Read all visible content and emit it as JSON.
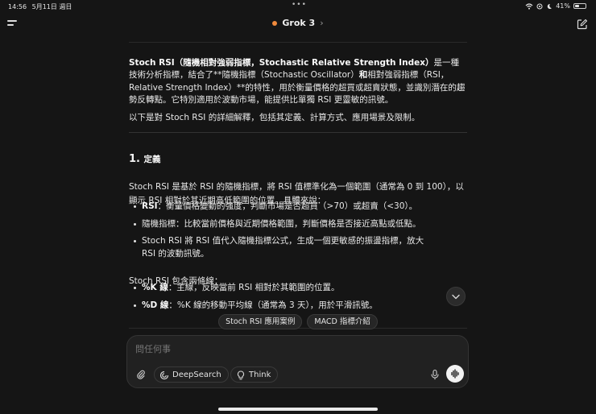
{
  "status_bar": {
    "time": "14:56",
    "date": "5月11日 週日",
    "battery": "41%",
    "battery_level": 0.41
  },
  "header": {
    "model_name": "Grok 3",
    "accent_color": "#f08a3c"
  },
  "article": {
    "intro_bold_1": "Stoch RSI（隨機相對強弱指標，Stochastic Relative Strength Index）",
    "intro_text_1": "是一種技術分析指標，結合了**隨機指標（Stochastic Oscillator）",
    "intro_bold_2": "和",
    "intro_text_2": "相對強弱指標（RSI，Relative Strength Index）**的特性，用於衡量價格的超買或超賣狀態，並識別潛在的趨勢反轉點。它特別適用於波動市場，能提供比單獨 RSI 更靈敏的訊號。",
    "intro_2": "以下是對 Stoch RSI 的詳細解釋，包括其定義、計算方式、應用場景及限制。",
    "section_1_number": "1.",
    "section_1_title": "定義",
    "section_1_para": "Stoch RSI 是基於 RSI 的隨機指標，將 RSI 值標準化為一個範圍（通常為 0 到 100），以顯示 RSI 相對於其近期高低範圍的位置。具體來說：",
    "bullets_1": [
      {
        "bold": "RSI",
        "text": "：衡量價格變動的強度，判斷市場是否超買（>70）或超賣（<30）。"
      },
      {
        "bold": "",
        "text": "隨機指標：比較當前價格與近期價格範圍，判斷價格是否接近高點或低點。"
      },
      {
        "bold": "",
        "text": "Stoch RSI 將 RSI 值代入隨機指標公式，生成一個更敏感的振盪指標，放大 RSI 的波動訊號。"
      }
    ],
    "lines_intro": "Stoch RSI 包含兩條線：",
    "bullets_2": [
      {
        "bold": "%K 線",
        "text": "：主線，反映當前 RSI 相對於其範圍的位置。"
      },
      {
        "bold": "%D 線",
        "text": "：%K 線的移動平均線（通常為 3 天），用於平滑訊號。"
      }
    ]
  },
  "suggestions": [
    "Stoch RSI 應用案例",
    "MACD 指標介紹"
  ],
  "composer": {
    "placeholder": "問任何事",
    "deepsearch_label": "DeepSearch",
    "think_label": "Think"
  },
  "icons": {
    "menu": "menu-icon",
    "edit": "new-chat-icon",
    "attach": "paperclip-icon",
    "deepsearch": "deepsearch-icon",
    "think": "lightbulb-icon",
    "mic": "microphone-icon",
    "voice": "voice-wave-icon",
    "scroll": "chevron-down-icon"
  }
}
